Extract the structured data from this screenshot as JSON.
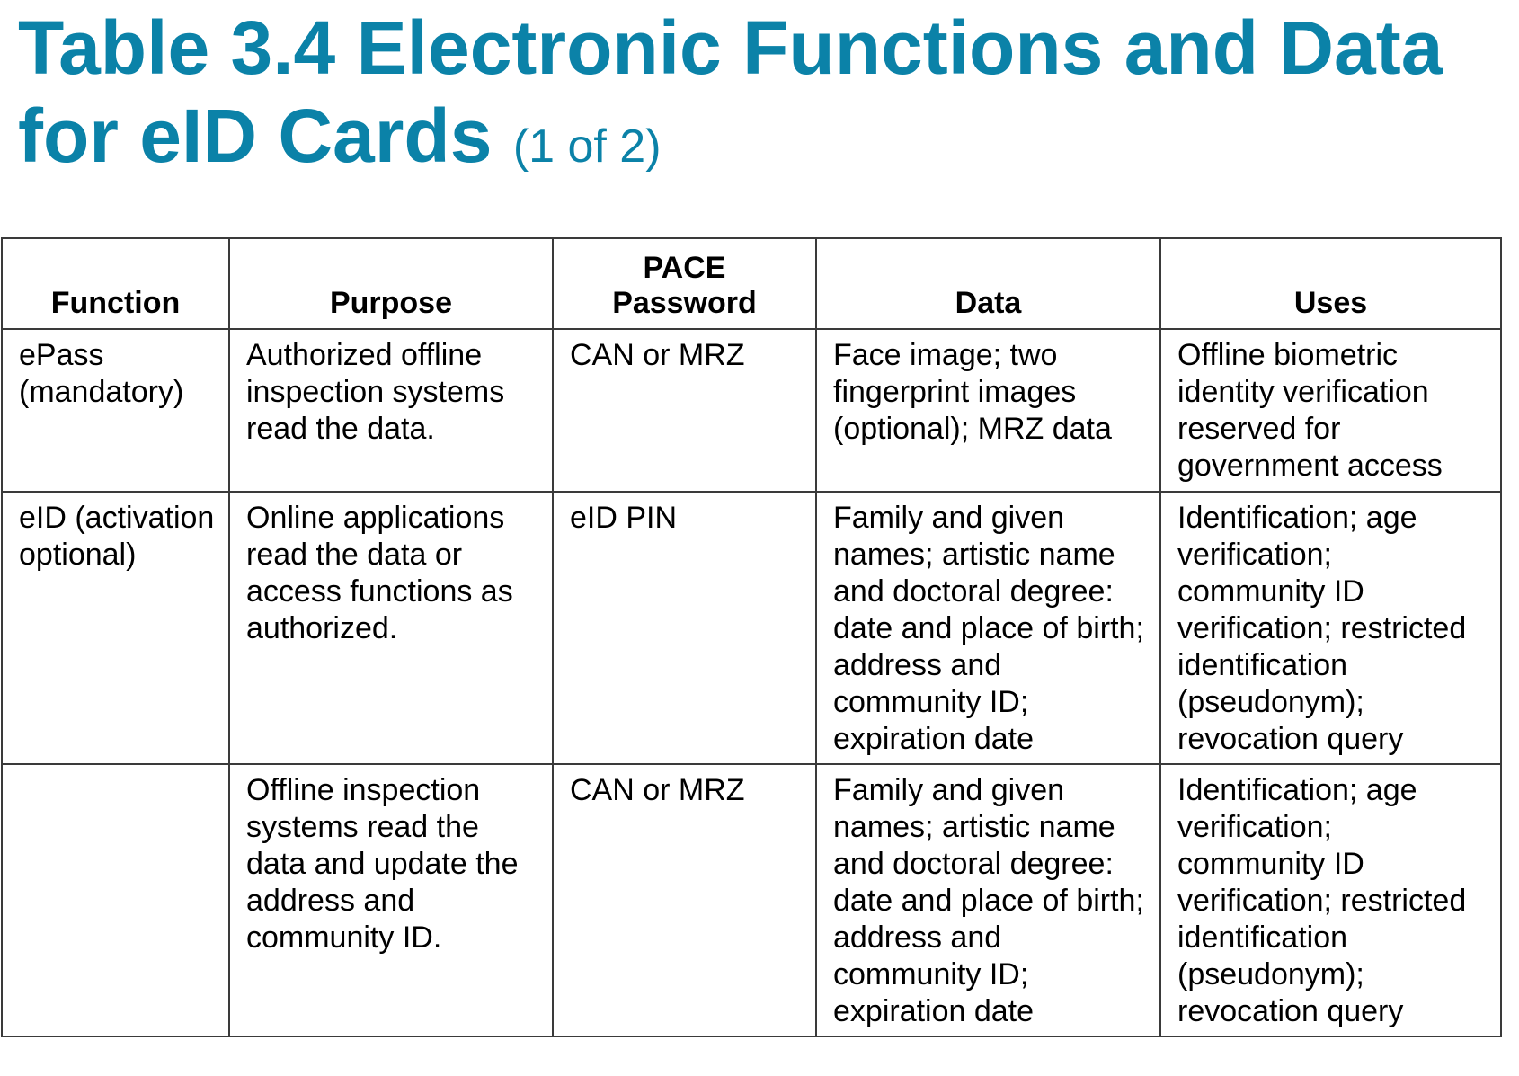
{
  "title": {
    "line1": "Table 3.4 Electronic Functions and Data",
    "line2": "for eID Cards",
    "suffix": "(1 of 2)"
  },
  "colors": {
    "title": "#0b82a8",
    "text": "#000000",
    "border": "#3a3a3a"
  },
  "table": {
    "headers": {
      "function": "Function",
      "purpose": "Purpose",
      "pace_line1": "PACE",
      "pace_line2": "Password",
      "data": "Data",
      "uses": "Uses"
    },
    "rows": [
      {
        "function": "ePass (mandatory)",
        "purpose": "Authorized offline inspection systems read the data.",
        "pace": "CAN or MRZ",
        "data": "Face image; two fingerprint images (optional); MRZ data",
        "uses": "Offline biometric identity verification reserved for government access"
      },
      {
        "function": "eID (activation optional)",
        "purpose": "Online applications read the data or access functions as authorized.",
        "pace": "eID PIN",
        "data": "Family and given names; artistic name and doctoral degree: date and place of birth; address and community ID; expiration date",
        "uses": "Identification; age verification; community ID verification; restricted identification (pseudonym); revocation query"
      },
      {
        "function": "",
        "purpose": "Offline inspection systems read the data and update the address and community ID.",
        "pace": "CAN or MRZ",
        "data": "Family and given names; artistic name and doctoral degree: date and place of birth; address and community ID; expiration date",
        "uses": "Identification; age verification; community ID verification; restricted identification (pseudonym); revocation query"
      }
    ]
  }
}
